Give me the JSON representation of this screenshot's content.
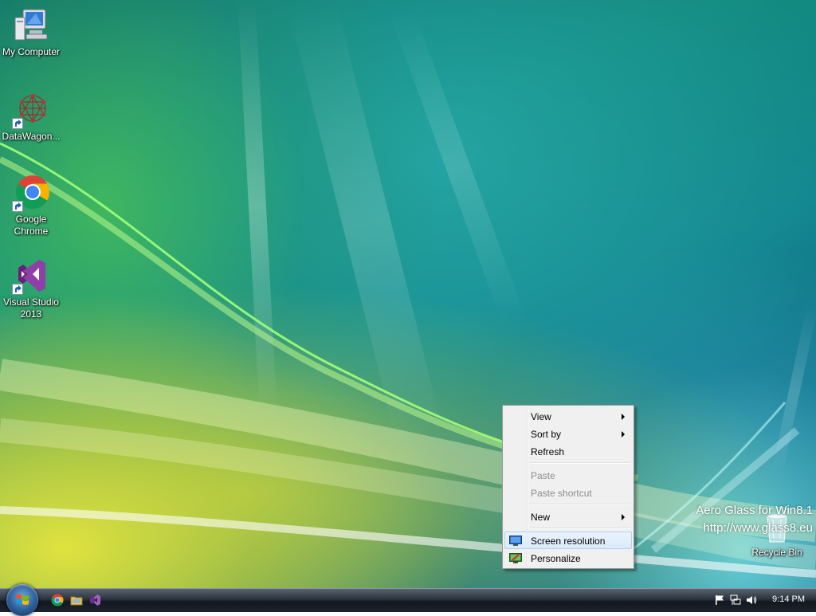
{
  "desktop": {
    "icons": [
      {
        "label": "My Computer",
        "icon": "computer-icon"
      },
      {
        "label": "DataWagon...",
        "icon": "datawagon-icon"
      },
      {
        "label": "Google Chrome",
        "icon": "chrome-icon"
      },
      {
        "label": "Visual Studio 2013",
        "icon": "visual-studio-icon"
      }
    ],
    "recycle_bin": {
      "label": "Recycle Bin",
      "icon": "recycle-bin-icon"
    },
    "watermark": {
      "line1": "Aero Glass for Win8.1",
      "line2": "http://www.glass8.eu"
    }
  },
  "context_menu": {
    "items": [
      {
        "label": "View",
        "submenu": true,
        "enabled": true
      },
      {
        "label": "Sort by",
        "submenu": true,
        "enabled": true
      },
      {
        "label": "Refresh",
        "submenu": false,
        "enabled": true
      },
      {
        "label": "Paste",
        "submenu": false,
        "enabled": false
      },
      {
        "label": "Paste shortcut",
        "submenu": false,
        "enabled": false
      },
      {
        "label": "New",
        "submenu": true,
        "enabled": true
      },
      {
        "label": "Screen resolution",
        "submenu": false,
        "enabled": true,
        "highlighted": true,
        "icon": "screen-resolution-icon"
      },
      {
        "label": "Personalize",
        "submenu": false,
        "enabled": true,
        "icon": "personalize-icon"
      }
    ]
  },
  "taskbar": {
    "pinned": [
      {
        "name": "Google Chrome",
        "icon": "chrome-icon"
      },
      {
        "name": "File Explorer",
        "icon": "folder-icon"
      },
      {
        "name": "Visual Studio",
        "icon": "visual-studio-icon"
      }
    ],
    "tray_icons": [
      "action-center-flag-icon",
      "network-icon",
      "volume-icon"
    ],
    "clock": "9:14 PM"
  },
  "colors": {
    "menu_highlight": "#dbeaf9",
    "menu_highlight_border": "#aecff7",
    "taskbar": "#1c232c"
  }
}
